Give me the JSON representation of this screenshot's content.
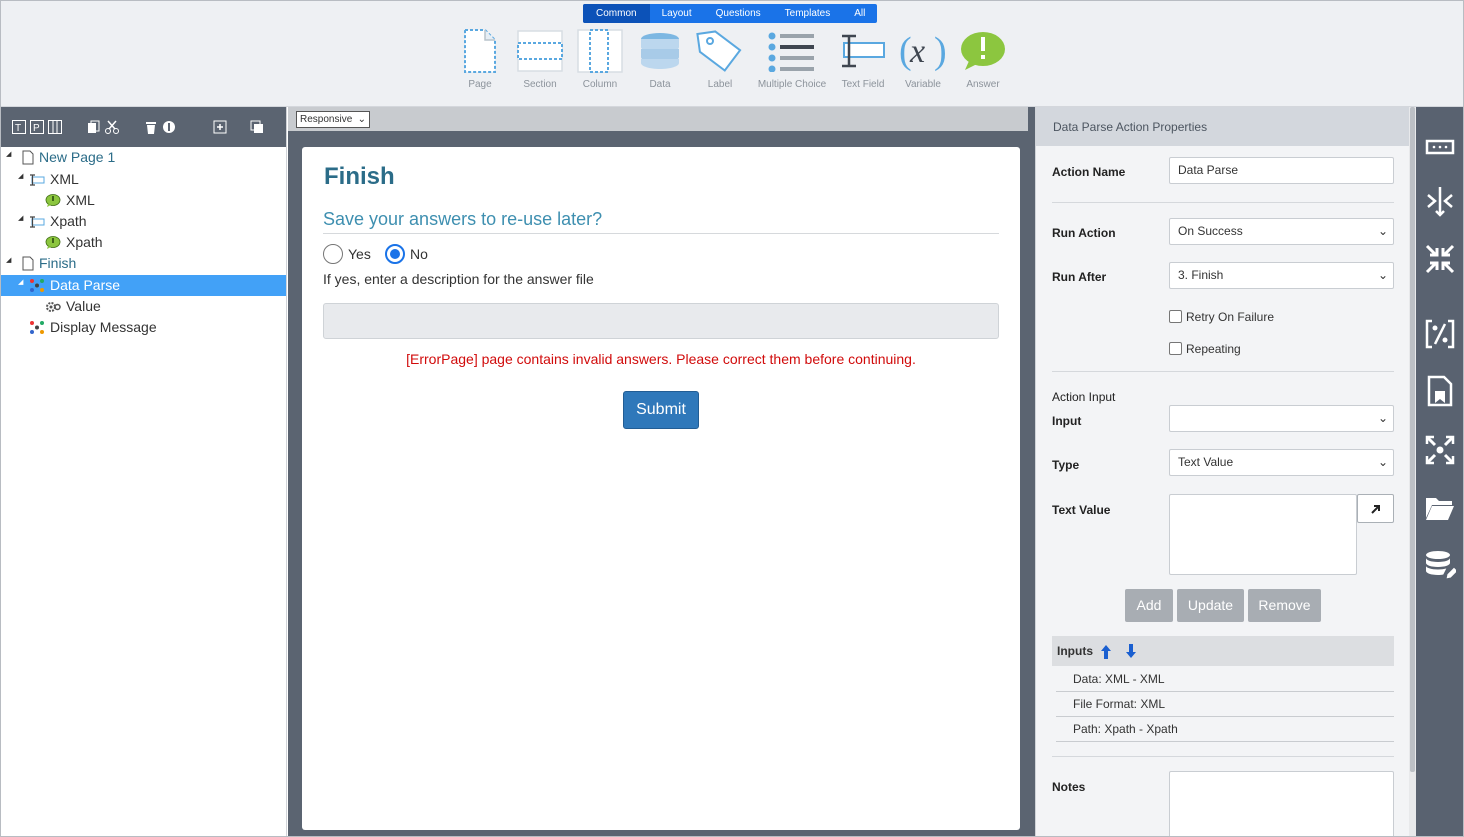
{
  "toolbar": {
    "tabs": [
      "Common",
      "Layout",
      "Questions",
      "Templates",
      "All"
    ],
    "active_tab": "Common",
    "tools": [
      {
        "label": "Page",
        "icon": "page-icon"
      },
      {
        "label": "Section",
        "icon": "section-icon"
      },
      {
        "label": "Column",
        "icon": "column-icon"
      },
      {
        "label": "Data",
        "icon": "database-icon"
      },
      {
        "label": "Label",
        "icon": "tag-icon"
      },
      {
        "label": "Multiple Choice",
        "icon": "list-icon"
      },
      {
        "label": "Text Field",
        "icon": "text-field-icon"
      },
      {
        "label": "Variable",
        "icon": "variable-icon"
      },
      {
        "label": "Answer",
        "icon": "answer-icon"
      }
    ]
  },
  "tree": {
    "items": [
      {
        "label": "New Page 1",
        "icon": "page-icon"
      },
      {
        "label": "XML",
        "icon": "textfield-icon"
      },
      {
        "label": "XML",
        "icon": "answer-bubble-icon"
      },
      {
        "label": "Xpath",
        "icon": "textfield-icon"
      },
      {
        "label": "Xpath",
        "icon": "answer-bubble-icon"
      },
      {
        "label": "Finish",
        "icon": "page-icon"
      },
      {
        "label": "Data Parse",
        "icon": "action-icon"
      },
      {
        "label": "Value",
        "icon": "gear-icon"
      },
      {
        "label": "Display Message",
        "icon": "action-icon"
      }
    ]
  },
  "center": {
    "layout_select": "Responsive",
    "form": {
      "title": "Finish",
      "question": "Save your answers to re-use later?",
      "options": [
        "Yes",
        "No"
      ],
      "selected": "No",
      "hint": "If yes, enter a description for the answer file",
      "error": "[ErrorPage] page contains invalid answers. Please correct them before continuing.",
      "submit": "Submit"
    }
  },
  "properties": {
    "header": "Data Parse Action Properties",
    "action_name_label": "Action Name",
    "action_name_value": "Data Parse",
    "run_action_label": "Run Action",
    "run_action_value": "On Success",
    "run_after_label": "Run After",
    "run_after_value": "3. Finish",
    "retry_label": "Retry On Failure",
    "repeating_label": "Repeating",
    "action_input_label": "Action Input",
    "input_label": "Input",
    "input_value": "",
    "type_label": "Type",
    "type_value": "Text Value",
    "text_value_label": "Text Value",
    "buttons": {
      "add": "Add",
      "update": "Update",
      "remove": "Remove"
    },
    "inputs_header": "Inputs",
    "inputs": [
      "Data: XML - XML",
      "File Format: XML",
      "Path: Xpath - Xpath"
    ],
    "notes_label": "Notes"
  },
  "colors": {
    "accent": "#1a73e8",
    "selected_row": "#42a1f7",
    "title": "#2b6c88",
    "error": "#d10b0b",
    "submit": "#2f78ba",
    "panel_dark": "#5b6471"
  }
}
